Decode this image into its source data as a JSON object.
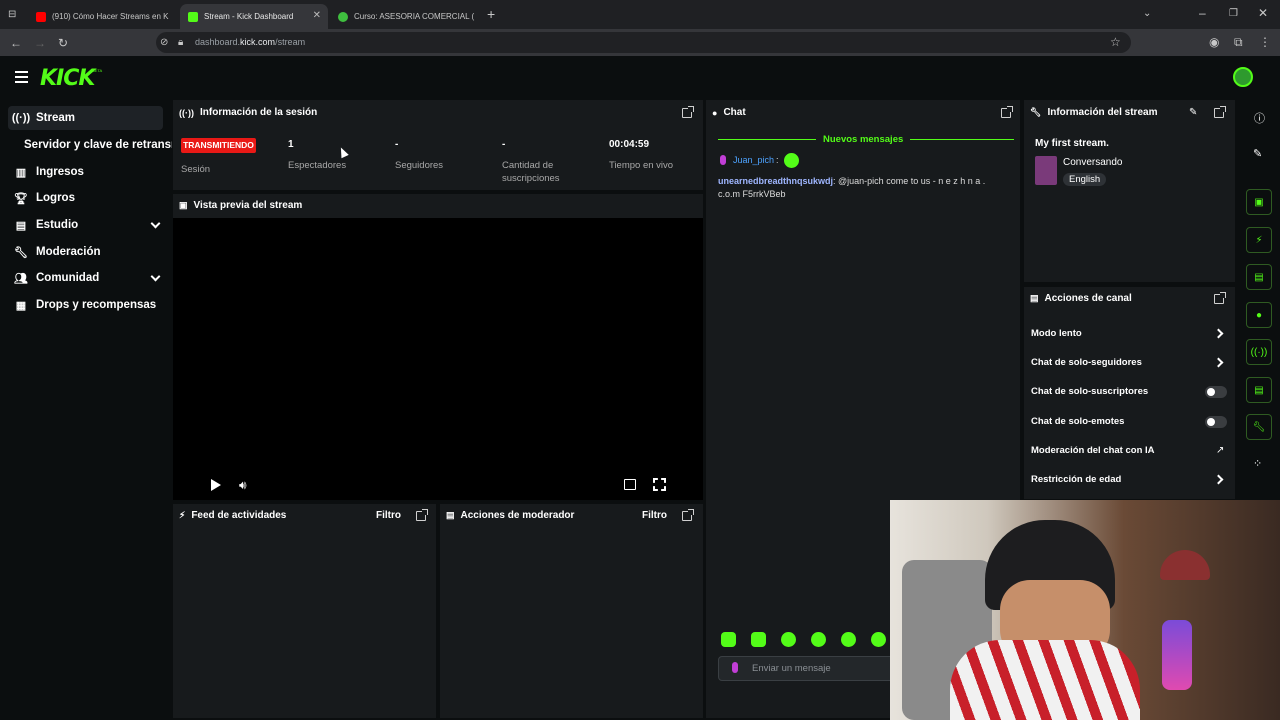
{
  "browser": {
    "tabs": [
      {
        "label": "(910) Cómo Hacer Streams en K",
        "favicon_color": "#ff0000"
      },
      {
        "label": "Stream - Kick Dashboard",
        "favicon_color": "#53fc18"
      },
      {
        "label": "Curso: ASESORIA COMERCIAL (",
        "favicon_color": "#3fbf3f"
      }
    ],
    "url_prefix": "dashboard.",
    "url_domain": "kick.com",
    "url_path": "/stream"
  },
  "header": {
    "logo": "KICK",
    "beta": "BETA"
  },
  "sidebar": {
    "items": [
      {
        "label": "Stream",
        "icon": "broadcast-icon"
      },
      {
        "label": "Servidor y clave de retransm",
        "icon": ""
      },
      {
        "label": "Ingresos",
        "icon": "bar-chart-icon"
      },
      {
        "label": "Logros",
        "icon": "trophy-icon"
      },
      {
        "label": "Estudio",
        "icon": "layout-icon"
      },
      {
        "label": "Moderación",
        "icon": "wrench-icon"
      },
      {
        "label": "Comunidad",
        "icon": "people-icon"
      },
      {
        "label": "Drops y recompensas",
        "icon": "gift-icon"
      }
    ]
  },
  "session": {
    "title": "Información de la sesión",
    "status": "TRANSMITIENDO",
    "status_label": "Sesión",
    "viewers_value": "1",
    "viewers_label": "Espectadores",
    "followers_value": "-",
    "followers_label": "Seguidores",
    "subs_value": "-",
    "subs_label": "Cantidad de suscripciones",
    "uptime_value": "00:04:59",
    "uptime_label": "Tiempo en vivo"
  },
  "preview": {
    "title": "Vista previa del stream"
  },
  "activity": {
    "title": "Feed de actividades",
    "filter": "Filtro"
  },
  "modactions": {
    "title": "Acciones de moderador",
    "filter": "Filtro"
  },
  "chat": {
    "title": "Chat",
    "new_messages": "Nuevos mensajes",
    "messages": [
      {
        "user": "Juan_pich",
        "text": ""
      },
      {
        "user": "unearnedbreadthnqsukwdj",
        "text": "@juan-pich come to us - n e z h n a . c.o.m F5rrkVBeb"
      }
    ],
    "input_placeholder": "Enviar un mensaje"
  },
  "stream_info": {
    "title": "Información del stream",
    "stream_title": "My first stream.",
    "category": "Conversando",
    "language": "English"
  },
  "channel_actions": {
    "title": "Acciones de canal",
    "items": [
      {
        "label": "Modo lento",
        "control": "arrow"
      },
      {
        "label": "Chat de solo-seguidores",
        "control": "arrow"
      },
      {
        "label": "Chat de solo-suscriptores",
        "control": "toggle"
      },
      {
        "label": "Chat de solo-emotes",
        "control": "toggle"
      },
      {
        "label": "Moderación del chat con IA",
        "control": "external"
      },
      {
        "label": "Restricción de edad",
        "control": "arrow"
      }
    ]
  },
  "colors": {
    "accent": "#53fc18",
    "live": "#e91916",
    "panel": "#171a1c"
  }
}
